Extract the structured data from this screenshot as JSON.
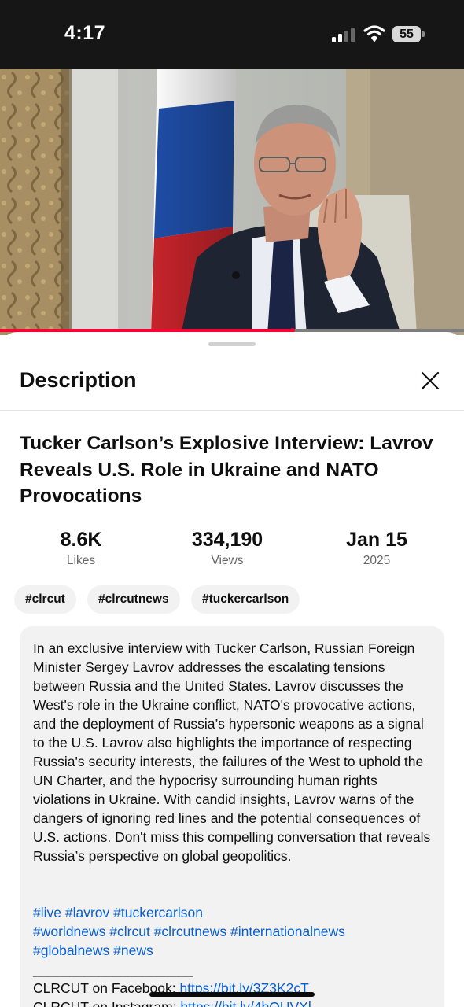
{
  "status_bar": {
    "time": "4:17",
    "battery": "55",
    "icons": [
      "signal-icon",
      "wifi-icon",
      "battery-icon"
    ]
  },
  "player": {
    "progress_fraction": 0.63,
    "accent_color": "#ff0033"
  },
  "sheet": {
    "title": "Description",
    "close_icon": "close-icon"
  },
  "video": {
    "title": "Tucker Carlson’s Explosive Interview: Lavrov Reveals U.S. Role in Ukraine and NATO Provocations",
    "stats": [
      {
        "value": "8.6K",
        "label": "Likes"
      },
      {
        "value": "334,190",
        "label": "Views"
      },
      {
        "value": "Jan 15",
        "label": "2025"
      }
    ],
    "chips": [
      "#clrcut",
      "#clrcutnews",
      "#tuckercarlson"
    ],
    "description": "In an exclusive interview with Tucker Carlson, Russian Foreign Minister Sergey Lavrov addresses the escalating tensions between Russia and the United States. Lavrov discusses the West's role in the Ukraine conflict, NATO's provocative actions, and the deployment of Russia’s hypersonic weapons as a signal to the U.S. Lavrov also highlights the importance of respecting Russia's security interests, the failures of the West to uphold the UN Charter, and the hypocrisy surrounding human rights violations in Ukraine. With candid insights, Lavrov warns of the dangers of ignoring red lines and the potential consequences of U.S. actions. Don't miss this compelling conversation that reveals Russia’s perspective on global geopolitics.",
    "hashtags_line1": [
      "#live",
      "#lavrov",
      "#tuckercarlson"
    ],
    "hashtags_line2": [
      "#worldnews",
      "#clrcut",
      "#clrcutnews",
      "#internationalnews"
    ],
    "hashtags_line3": [
      "#globalnews",
      "#news"
    ],
    "divider": "______________________",
    "facebook_label": "CLRCUT on Facebook: ",
    "facebook_link": "https://bit.ly/3Z3K2cT",
    "instagram_label": "CLRCUT on Instagram: ",
    "instagram_link": "https://bit.ly/4bOUVXl",
    "link_color": "#065fd4"
  }
}
